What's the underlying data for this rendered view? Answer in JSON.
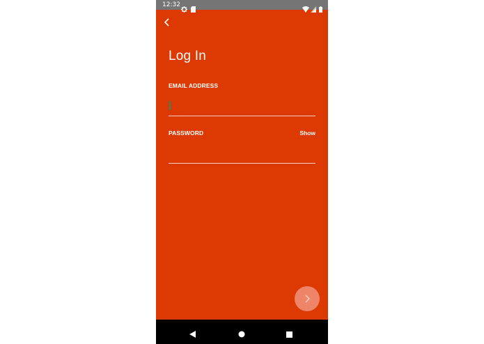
{
  "status_bar": {
    "time": "12:32",
    "icons": [
      "gear-icon",
      "sd-card-icon",
      "wifi-icon",
      "signal-icon",
      "battery-icon"
    ]
  },
  "header": {
    "back_icon": "chevron-left-icon"
  },
  "form": {
    "title": "Log In",
    "email": {
      "label": "EMAIL ADDRESS",
      "value": ""
    },
    "password": {
      "label": "PASSWORD",
      "value": "",
      "toggle_label": "Show"
    },
    "submit_icon": "chevron-right-icon"
  },
  "nav_bar": {
    "buttons": [
      "back-triangle-icon",
      "home-circle-icon",
      "recents-square-icon"
    ]
  },
  "colors": {
    "background": "#dc3a02",
    "status_bar": "#757575",
    "submit_button": "#ee8568",
    "nav_bar": "#000000"
  }
}
